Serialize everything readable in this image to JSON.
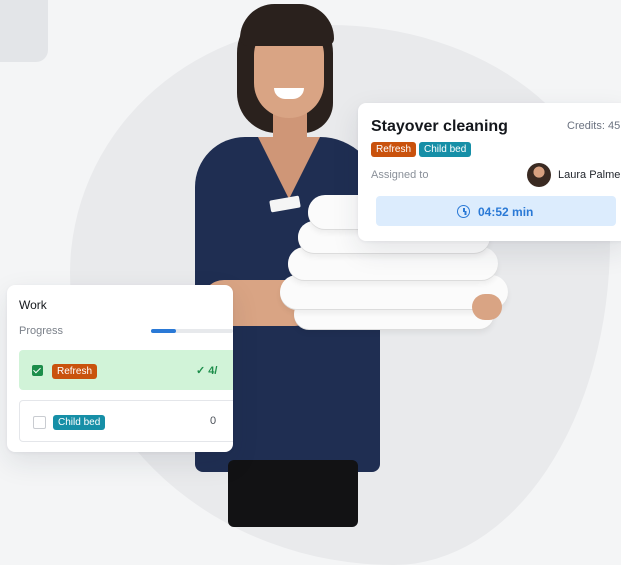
{
  "task_card": {
    "title": "Stayover cleaning",
    "credits": "Credits: 45",
    "tags": [
      "Refresh",
      "Child bed"
    ],
    "assigned_label": "Assigned to",
    "assignee": "Laura Palmer",
    "timer": "04:52 min"
  },
  "work_card": {
    "title": "Work",
    "progress_label": "Progress",
    "progress_value": 0.3,
    "rows": [
      {
        "tag": "Refresh",
        "checked": true,
        "count": "✓ 4/"
      },
      {
        "tag": "Child bed",
        "checked": false,
        "count": "0"
      }
    ]
  },
  "colors": {
    "tag_refresh": "#c9520d",
    "tag_child_bed": "#168fa7",
    "accent_blue": "#2a79d6",
    "done_green": "#1c8d4a"
  },
  "icons": [
    "clock-icon",
    "checkbox-checked-icon",
    "checkbox-empty-icon"
  ]
}
